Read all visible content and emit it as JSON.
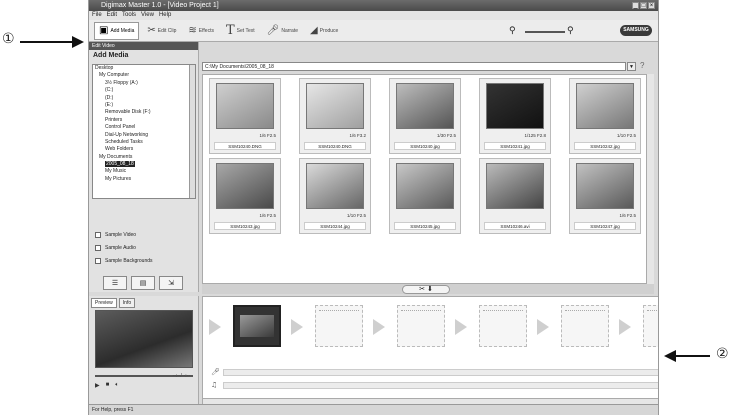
{
  "callouts": {
    "one": "①",
    "two": "②"
  },
  "window": {
    "title": "Digimax Master 1.0 - [Video Project 1]",
    "controls": [
      "_",
      "□",
      "×"
    ]
  },
  "menu": [
    "File",
    "Edit",
    "Tools",
    "View",
    "Help"
  ],
  "toolbar": {
    "add_media": "Add Media",
    "edit_clip": "Edit Clip",
    "effects": "Effects",
    "set_text": "Set Text",
    "narrate": "Narrate",
    "produce": "Produce",
    "brand": "SAMSUNG"
  },
  "left_panel": {
    "header": "Edit Video",
    "title": "Add Media",
    "tree": [
      "Desktop",
      "My Computer",
      "3½ Floppy (A:)",
      "(C:)",
      "(D:)",
      "(E:)",
      "Removable Disk (F:)",
      "Printers",
      "Control Panel",
      "Dial-Up Networking",
      "Scheduled Tasks",
      "Web Folders",
      "My Documents",
      "2005_08_18",
      "My Music",
      "My Pictures"
    ],
    "selected_folder": "2005_08_18",
    "samples": [
      "Sample Video",
      "Sample Audio",
      "Sample Backgrounds"
    ]
  },
  "path": "C:\\My Documents\\2005_08_18",
  "thumbnails": [
    {
      "name": "SSM10240.DNG",
      "meta": "1/6 F2.5",
      "c1": "#8a8a8a",
      "c2": "#cfcfcf"
    },
    {
      "name": "SSM10240.DNG",
      "meta": "1/6 F3.2",
      "c1": "#a0a0a0",
      "c2": "#e6e6e6"
    },
    {
      "name": "SSM10240.jpg",
      "meta": "1/30 F2.5",
      "c1": "#555",
      "c2": "#bdbdbd"
    },
    {
      "name": "SSM10241.jpg",
      "meta": "1/125 F2.8",
      "c1": "#111",
      "c2": "#333"
    },
    {
      "name": "SSM10242.jpg",
      "meta": "1/10 F2.5",
      "c1": "#777",
      "c2": "#d0d0d0"
    },
    {
      "name": "SSM10243.jpg",
      "meta": "1/6 F2.5",
      "c1": "#4a4a4a",
      "c2": "#a8a8a8"
    },
    {
      "name": "SSM10244.jpg",
      "meta": "1/10 F2.5",
      "c1": "#666",
      "c2": "#dadada"
    },
    {
      "name": "SSM10245.jpg",
      "meta": "",
      "c1": "#5a5a5a",
      "c2": "#c8c8c8"
    },
    {
      "name": "SSM10246.avi",
      "meta": "",
      "c1": "#444",
      "c2": "#bbb"
    },
    {
      "name": "SSM10247.jpg",
      "meta": "1/6 F2.5",
      "c1": "#595959",
      "c2": "#c2c2c2"
    }
  ],
  "preview": {
    "tabs": [
      "Preview",
      "Info"
    ],
    "timecode": "--:--/--:--"
  },
  "status": "For Help, press F1"
}
